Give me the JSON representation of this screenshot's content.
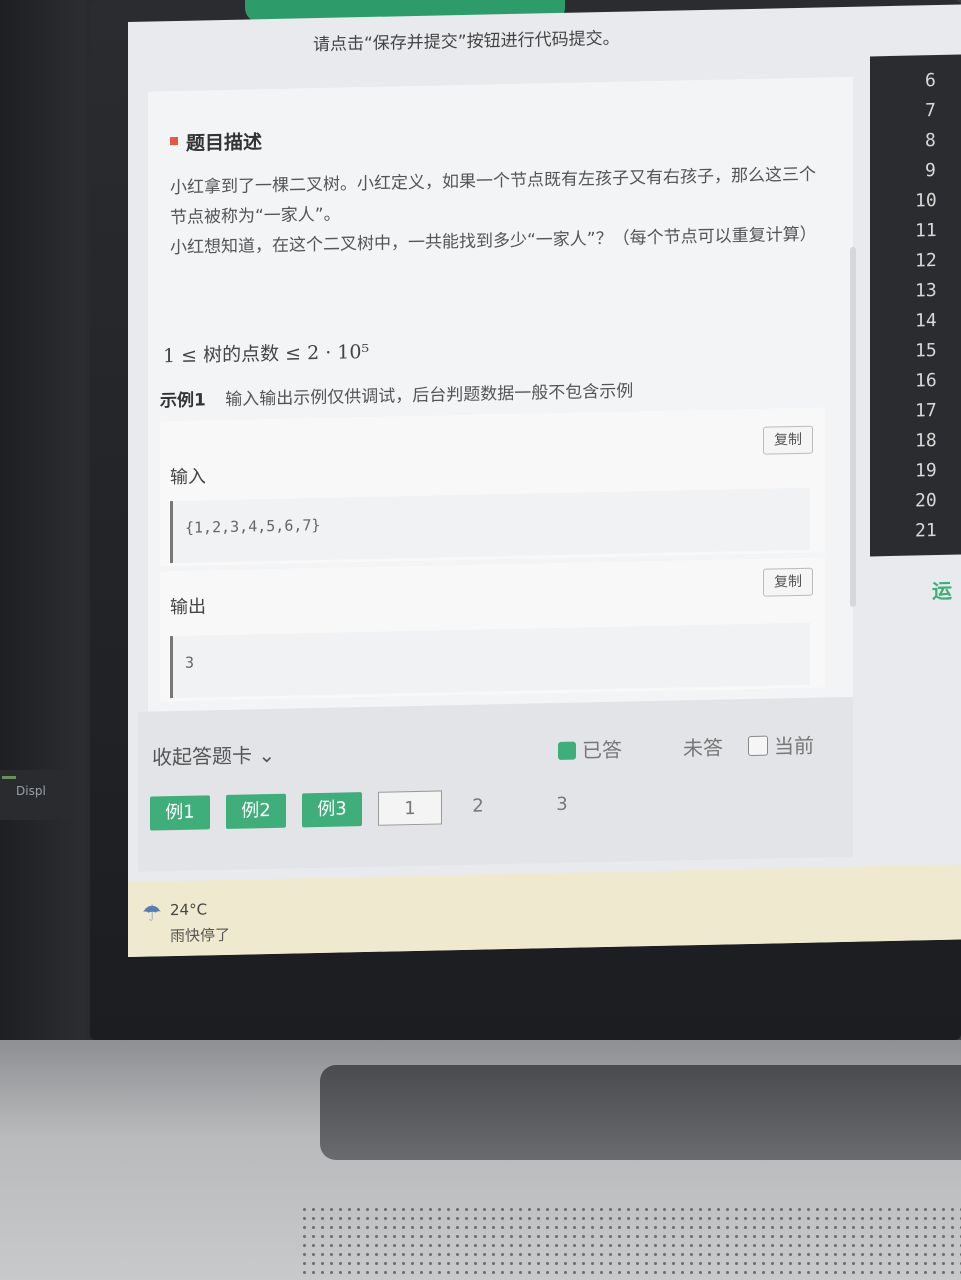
{
  "notice": "请点击“保存并提交”按钮进行代码提交。",
  "problem": {
    "section_title": "题目描述",
    "paragraph1": "小红拿到了一棵二叉树。小红定义，如果一个节点既有左孩子又有右孩子，那么这三个节点被称为“一家人”。",
    "paragraph2": "小红想知道，在这个二叉树中，一共能找到多少“一家人”？（每个节点可以重复计算）",
    "constraint": "1 ≤ 树的点数 ≤ 2 · 10⁵"
  },
  "example": {
    "label": "示例1",
    "note": "输入输出示例仅供调试，后台判题数据一般不包含示例",
    "input_label": "输入",
    "input_value": "{1,2,3,4,5,6,7}",
    "output_label": "输出",
    "output_value": "3",
    "copy_label": "复制"
  },
  "answer_card": {
    "collapse_label": "收起答题卡 ⌄",
    "legend_answered": "已答",
    "legend_unanswered": "未答",
    "legend_current": "当前",
    "examples": [
      "例1",
      "例2",
      "例3"
    ],
    "questions": [
      "1",
      "2",
      "3"
    ]
  },
  "editor": {
    "line_numbers": [
      "6",
      "7",
      "8",
      "9",
      "10",
      "11",
      "12",
      "13",
      "14",
      "15",
      "16",
      "17",
      "18",
      "19",
      "20",
      "21"
    ],
    "run_fragment": "运"
  },
  "taskbar": {
    "temperature": "24°C",
    "weather": "雨快停了"
  },
  "env": {
    "side_label": "Displ"
  }
}
